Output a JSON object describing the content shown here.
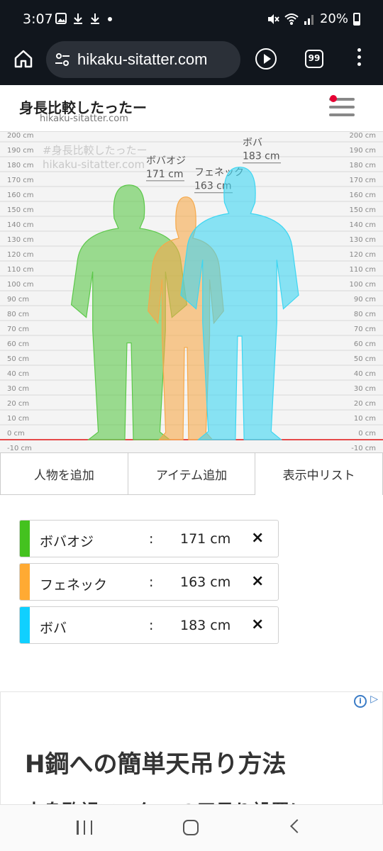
{
  "status_bar": {
    "time": "3:07",
    "icons": [
      "gallery-icon",
      "download-icon",
      "download-icon",
      "dot-icon"
    ],
    "battery": "20%"
  },
  "browser": {
    "url": "hikaku-sitatter.com",
    "tab_count": "99"
  },
  "site": {
    "title": "身長比較したったー",
    "subtitle": "hikaku-sitatter.com",
    "watermark_line1": "#身長比較したったー",
    "watermark_line2": "hikaku-sitatter.com"
  },
  "chart_data": {
    "type": "height-comparison",
    "unit": "cm",
    "ticks": [
      "200 cm",
      "190 cm",
      "180 cm",
      "170 cm",
      "160 cm",
      "150 cm",
      "140 cm",
      "130 cm",
      "120 cm",
      "110 cm",
      "100 cm",
      "90 cm",
      "80 cm",
      "70 cm",
      "60 cm",
      "50 cm",
      "40 cm",
      "30 cm",
      "20 cm",
      "10 cm",
      "0 cm",
      "-10 cm"
    ],
    "ylim": [
      -10,
      200
    ],
    "people": [
      {
        "name": "ボバオジ",
        "height": 171,
        "height_label": "171 cm",
        "color": "#5cc84a"
      },
      {
        "name": "フェネック",
        "height": 163,
        "height_label": "163 cm",
        "color": "#f6a94a"
      },
      {
        "name": "ボバ",
        "height": 183,
        "height_label": "183 cm",
        "color": "#3ed6f2"
      }
    ]
  },
  "tabs": [
    {
      "label": "人物を追加"
    },
    {
      "label": "アイテム追加"
    },
    {
      "label": "表示中リスト"
    }
  ],
  "list": {
    "separator": ":",
    "delete_symbol": "×",
    "items": [
      {
        "name": "ボバオジ",
        "height": "171 cm",
        "color": "#44c21f"
      },
      {
        "name": "フェネック",
        "height": "163 cm",
        "color": "#ffaa33"
      },
      {
        "name": "ボバ",
        "height": "183 cm",
        "color": "#10d0ff"
      }
    ]
  },
  "ad": {
    "title": "H鋼への簡単天吊り方法",
    "text": "中身監視モニター の天吊り設置に"
  }
}
